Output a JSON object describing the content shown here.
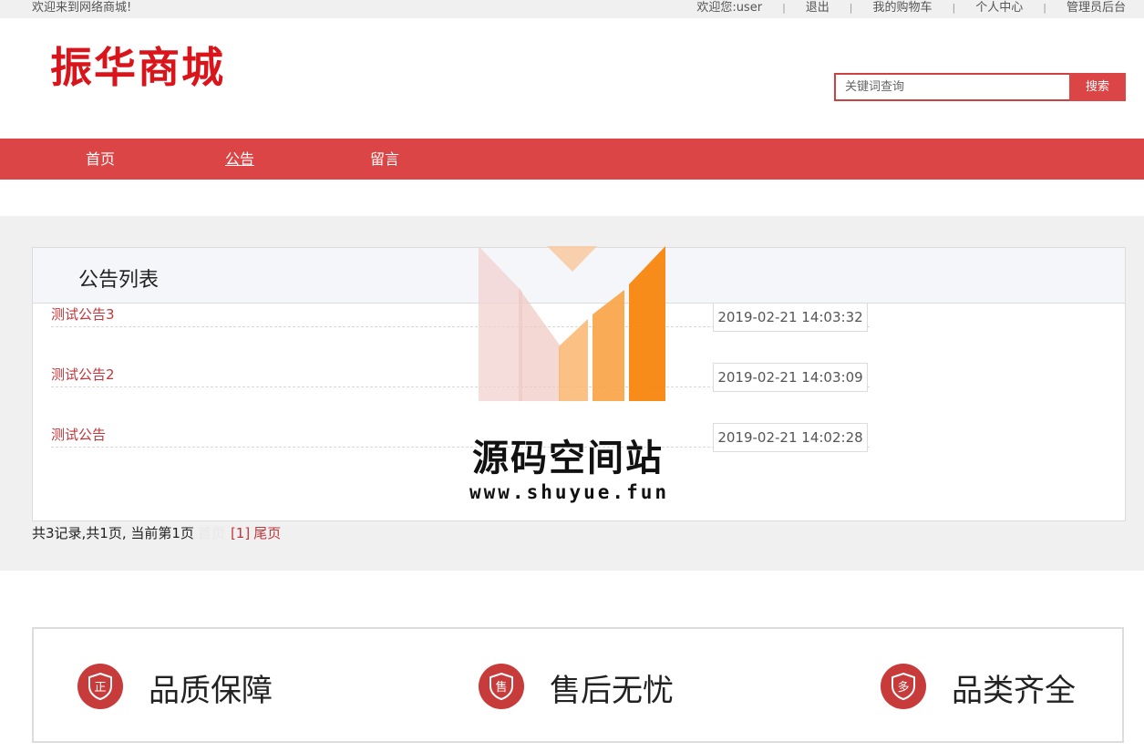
{
  "topbar": {
    "welcome": "欢迎来到网络商城!",
    "user_greeting": "欢迎您:user",
    "logout": "退出",
    "cart": "我的购物车",
    "profile": "个人中心",
    "admin": "管理员后台"
  },
  "header": {
    "logo_text": "振华商城",
    "search_placeholder": "关键词查询",
    "search_button": "搜索"
  },
  "nav": {
    "items": [
      "首页",
      "公告",
      "留言"
    ]
  },
  "notices": {
    "title": "公告列表",
    "items": [
      {
        "title": "测试公告3",
        "date": "2019-02-21 14:03:32"
      },
      {
        "title": "测试公告2",
        "date": "2019-02-21 14:03:09"
      },
      {
        "title": "测试公告",
        "date": "2019-02-21 14:02:28"
      }
    ]
  },
  "pager": {
    "summary": "共3记录,共1页, 当前第1页",
    "first": "首页",
    "current": "[1]",
    "last": "尾页"
  },
  "watermark": {
    "title": "源码空间站",
    "url": "www.shuyue.fun"
  },
  "features": [
    {
      "icon": "shield-icon",
      "glyph": "正",
      "label": "品质保障"
    },
    {
      "icon": "shield-icon",
      "glyph": "售",
      "label": "售后无忧"
    },
    {
      "icon": "shield-icon",
      "glyph": "多",
      "label": "品类齐全"
    }
  ],
  "colors": {
    "accent": "#dc4545",
    "logo": "#d9141b",
    "link": "#c0373b",
    "band": "#f0f0f0"
  }
}
